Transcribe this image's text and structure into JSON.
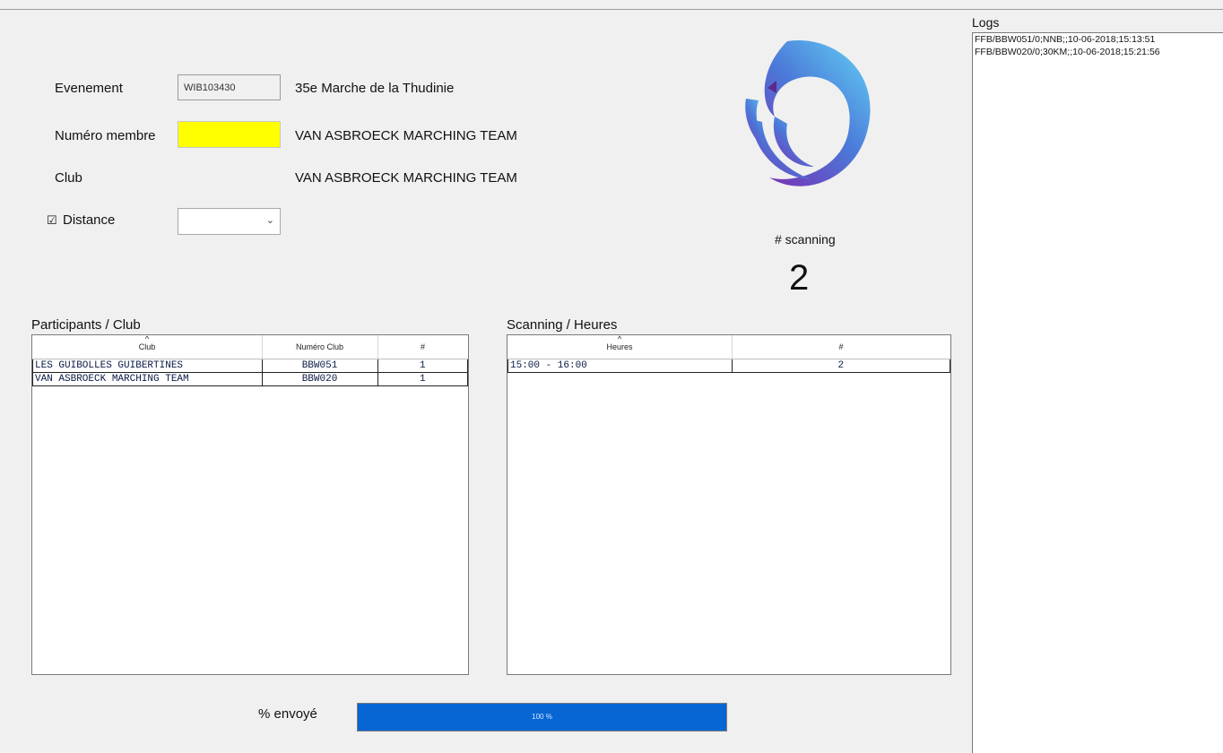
{
  "form": {
    "evenement_label": "Evenement",
    "evenement_code": "WIB103430",
    "evenement_name": "35e Marche de la Thudinie",
    "numero_label": "Numéro membre",
    "numero_value": "",
    "numero_name": "VAN ASBROECK MARCHING TEAM",
    "club_label": "Club",
    "club_value": "VAN ASBROECK MARCHING TEAM",
    "distance_checkbox": "☑",
    "distance_label": "Distance",
    "distance_value": ""
  },
  "scanning": {
    "label": "# scanning",
    "count": "2"
  },
  "participants": {
    "title": "Participants / Club",
    "columns": [
      "Club",
      "Numéro Club",
      "#"
    ],
    "rows": [
      {
        "club": "LES GUIBOLLES GUIBERTINES",
        "numero": "BBW051",
        "count": "1"
      },
      {
        "club": "VAN ASBROECK MARCHING TEAM",
        "numero": "BBW020",
        "count": "1"
      }
    ]
  },
  "scanning_heures": {
    "title": "Scanning / Heures",
    "columns": [
      "Heures",
      "#"
    ],
    "rows": [
      {
        "heures": "15:00 - 16:00",
        "count": "2"
      }
    ]
  },
  "progress": {
    "label": "% envoyé",
    "text": "100 %",
    "fraction": 1.0,
    "color": "#0766d4"
  },
  "logs": {
    "title": "Logs",
    "lines": [
      "FFB/BBW051/0;NNB;;10-06-2018;15:13:51",
      "FFB/BBW020/0;30KM;;10-06-2018;15:21:56"
    ]
  },
  "logo": {
    "icon": "bird-logo-icon",
    "colors": [
      "#7a2fb4",
      "#4b78d8",
      "#5ec3f0"
    ]
  }
}
